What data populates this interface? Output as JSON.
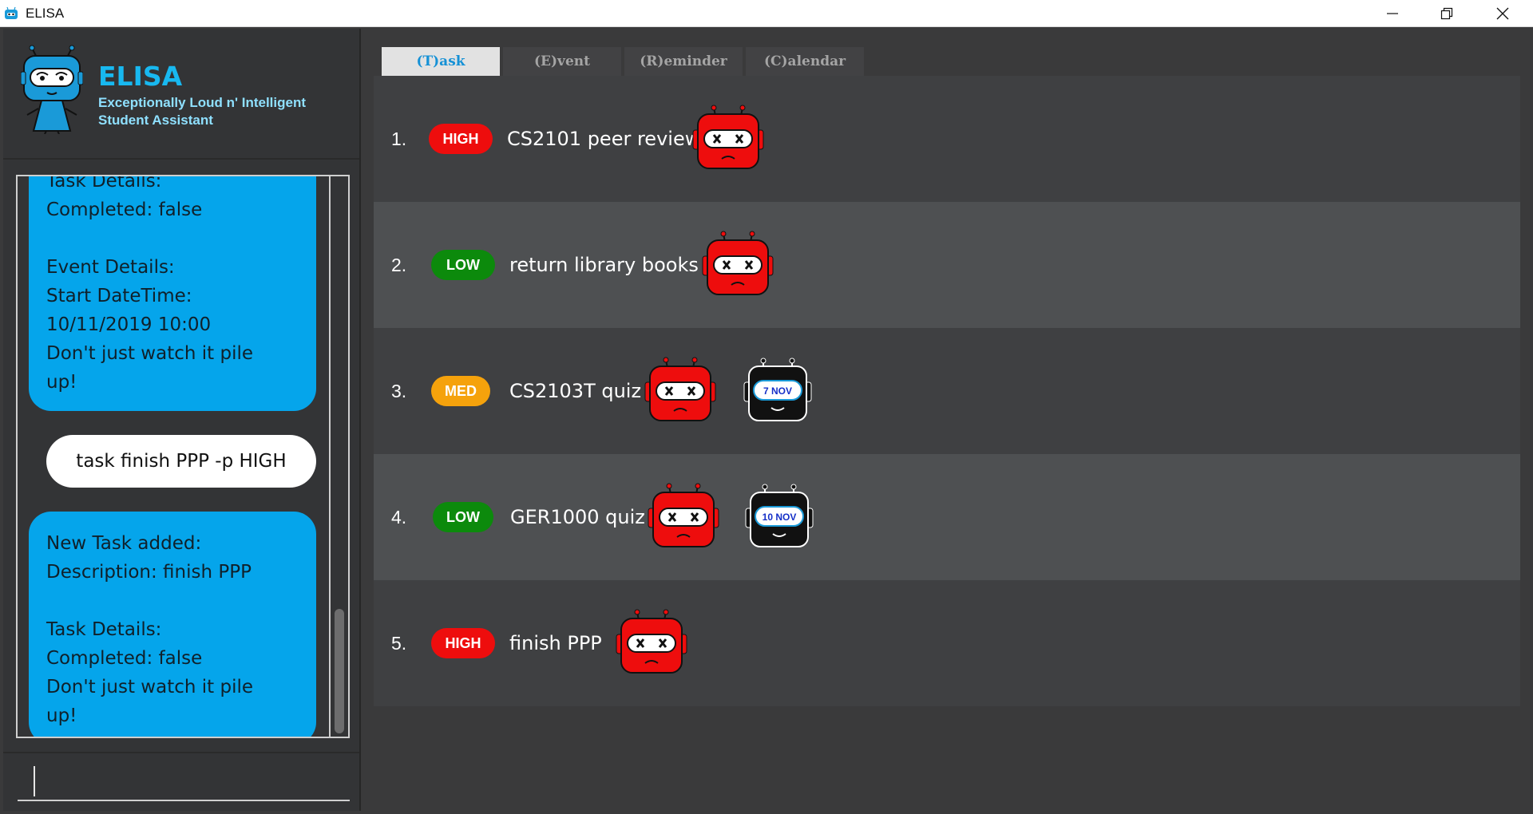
{
  "window": {
    "title": "ELISA",
    "controls": [
      "minimize",
      "restore",
      "close"
    ]
  },
  "header": {
    "app_name": "ELISA",
    "subtitle_line1": "Exceptionally Loud n' Intelligent",
    "subtitle_line2": "Student Assistant"
  },
  "chat": {
    "messages": [
      {
        "sender": "elisa",
        "text": "Task Details:\nCompleted: false\n\nEvent Details:\nStart DateTime:\n10/11/2019 10:00\nDon't just watch it pile\nup!"
      },
      {
        "sender": "user",
        "text": "task finish PPP -p HIGH"
      },
      {
        "sender": "elisa",
        "text": "New Task added:\nDescription: finish PPP\n\nTask Details:\nCompleted: false\nDon't just watch it pile\nup!"
      }
    ]
  },
  "command_input": {
    "value": ""
  },
  "tabs": [
    {
      "label": "(T)ask",
      "active": true
    },
    {
      "label": "(E)vent",
      "active": false
    },
    {
      "label": "(R)eminder",
      "active": false
    },
    {
      "label": "(C)alendar",
      "active": false
    }
  ],
  "tasks": [
    {
      "number": "1.",
      "priority": "HIGH",
      "description": "CS2101 peer review",
      "status_icons": [
        "incomplete-robot"
      ]
    },
    {
      "number": "2.",
      "priority": "LOW",
      "description": "return library books",
      "status_icons": [
        "incomplete-robot"
      ]
    },
    {
      "number": "3.",
      "priority": "MED",
      "description": "CS2103T quiz",
      "status_icons": [
        "incomplete-robot",
        "event-robot"
      ],
      "event_date": "7 NOV"
    },
    {
      "number": "4.",
      "priority": "LOW",
      "description": "GER1000 quiz",
      "status_icons": [
        "incomplete-robot",
        "event-robot"
      ],
      "event_date": "10 NOV"
    },
    {
      "number": "5.",
      "priority": "HIGH",
      "description": "finish PPP",
      "status_icons": [
        "incomplete-robot"
      ]
    }
  ],
  "colors": {
    "accent": "#18b8f0",
    "bubble": "#05a5eb",
    "high": "#ee0d0d",
    "low": "#0c8a0c",
    "med": "#f5a20c",
    "background": "#3a3a3b"
  }
}
